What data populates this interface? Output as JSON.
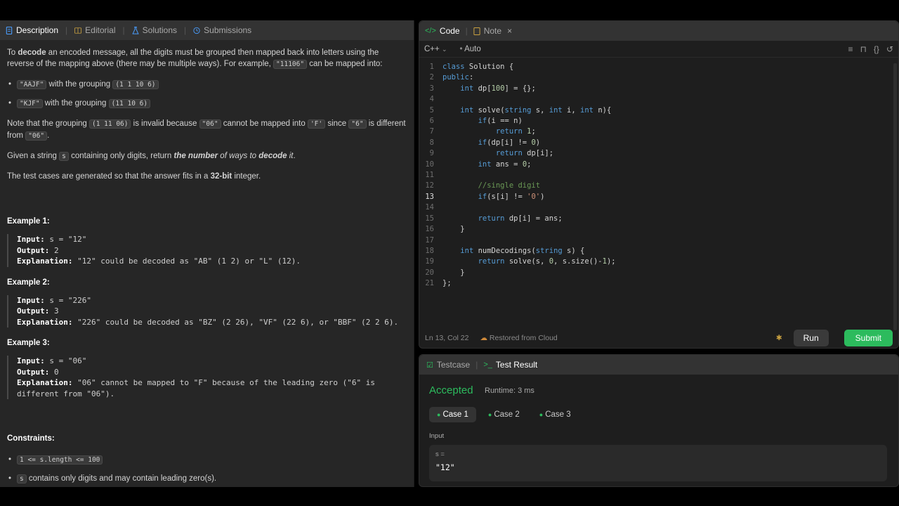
{
  "left_tabs": [
    "Description",
    "Editorial",
    "Solutions",
    "Submissions"
  ],
  "editor_tabs": [
    "Code",
    "Note"
  ],
  "language": "C++",
  "auto_label": "Auto",
  "status": {
    "position": "Ln 13, Col 22",
    "cloud": "Restored from Cloud"
  },
  "buttons": {
    "run": "Run",
    "submit": "Submit"
  },
  "result_tabs": [
    "Testcase",
    "Test Result"
  ],
  "result": {
    "verdict": "Accepted",
    "runtime": "Runtime: 3 ms",
    "cases": [
      "Case 1",
      "Case 2",
      "Case 3"
    ],
    "input_label": "Input",
    "input_var": "s =",
    "input_value": "\"12\""
  },
  "description": {
    "examples": [
      {
        "title": "Example 1:",
        "input": "s = \"12\"",
        "output": "2",
        "explanation": "\"12\" could be decoded as \"AB\" (1 2) or \"L\" (12)."
      },
      {
        "title": "Example 2:",
        "input": "s = \"226\"",
        "output": "3",
        "explanation": "\"226\" could be decoded as \"BZ\" (2 26), \"VF\" (22 6), or \"BBF\" (2 2 6)."
      },
      {
        "title": "Example 3:",
        "input": "s = \"06\"",
        "output": "0",
        "explanation": "\"06\" cannot be mapped to \"F\" because of the leading zero (\"6\" is\ndifferent from \"06\")."
      }
    ],
    "constraints_title": "Constraints:"
  },
  "code_lines": [
    "class Solution {",
    "public:",
    "    int dp[100] = {};",
    "",
    "    int solve(string s, int i, int n){",
    "        if(i == n)",
    "            return 1;",
    "        if(dp[i] != 0)",
    "            return dp[i];",
    "        int ans = 0;",
    "",
    "        //single digit",
    "        if(s[i] != '0')",
    "",
    "        return dp[i] = ans;",
    "    }",
    "",
    "    int numDecodings(string s) {",
    "        return solve(s, 0, s.size()-1);",
    "    }",
    "};"
  ],
  "current_line": 13
}
